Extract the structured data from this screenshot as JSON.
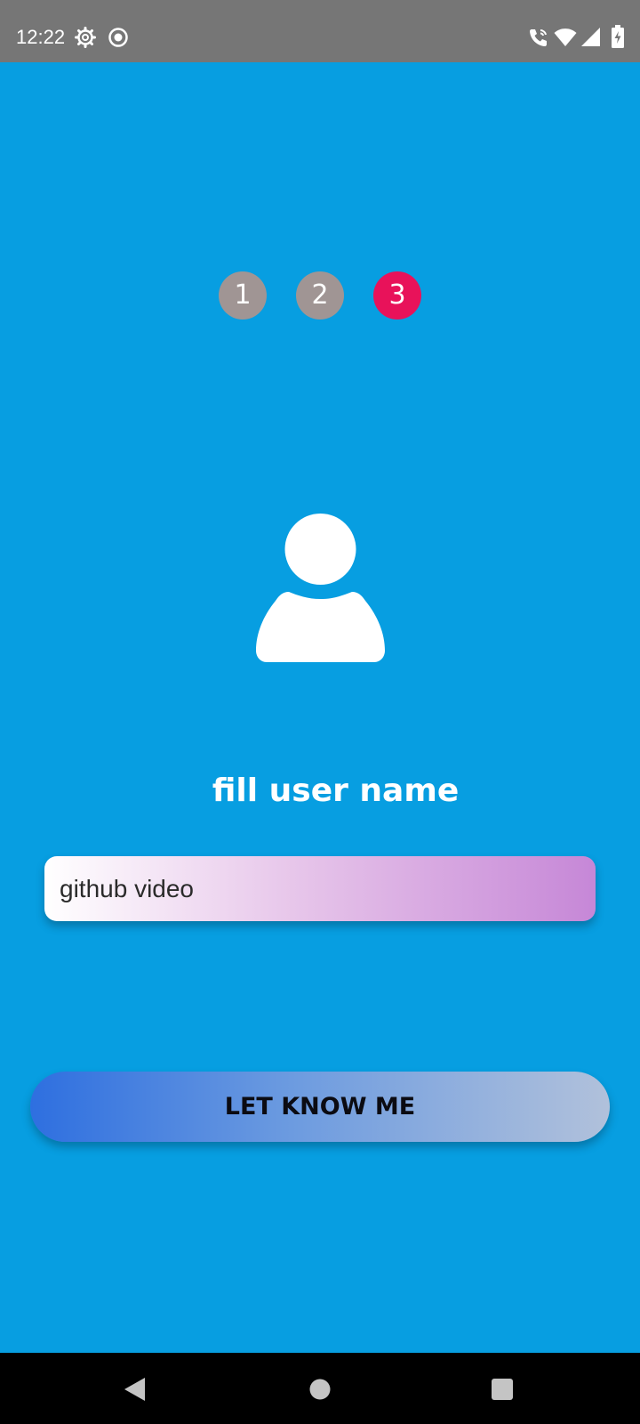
{
  "status_bar": {
    "time": "12:22",
    "icons": [
      "settings-gear-icon",
      "screen-record-icon",
      "wifi-calling-icon",
      "wifi-icon",
      "cellular-signal-icon",
      "battery-charging-icon"
    ]
  },
  "steps": [
    {
      "label": "1",
      "active": false,
      "color": "#A09594"
    },
    {
      "label": "2",
      "active": false,
      "color": "#A09594"
    },
    {
      "label": "3",
      "active": true,
      "color": "#E8125A"
    }
  ],
  "avatar": {
    "icon": "user-icon"
  },
  "prompt": {
    "label": "fill user name"
  },
  "name_input": {
    "value": "github video"
  },
  "submit_button": {
    "label": "LET KNOW ME"
  },
  "nav_bar": {
    "icons": [
      "back-icon",
      "home-icon",
      "recents-icon"
    ]
  },
  "colors": {
    "background": "#079EE1",
    "status_bar": "#767676",
    "active_step": "#E8125A",
    "inactive_step": "#A09594",
    "button_gradient_start": "#2E6FE0",
    "button_gradient_end": "#B1C1DB",
    "input_gradient_end": "#C687D7"
  }
}
